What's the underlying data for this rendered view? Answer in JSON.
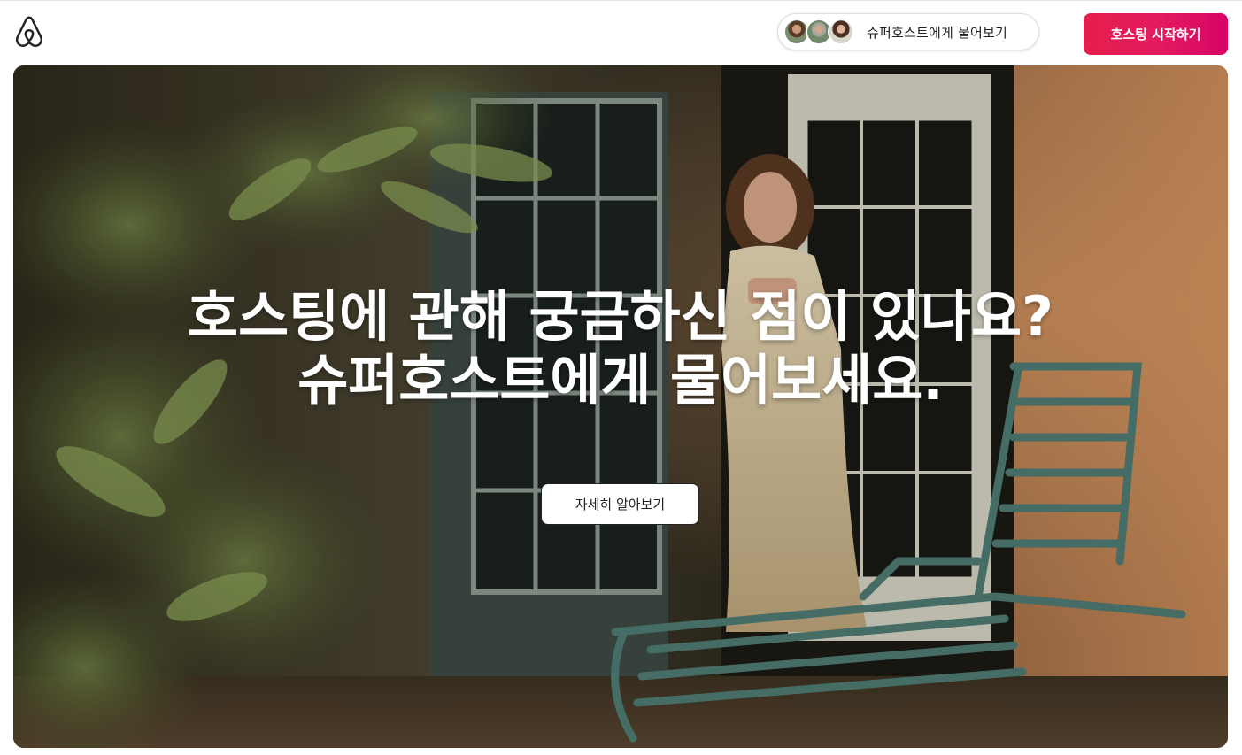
{
  "header": {
    "logo_icon": "airbnb-logo-icon",
    "ask_superhost_label": "슈퍼호스트에게 물어보기",
    "start_hosting_label": "호스팅 시작하기",
    "accent_color": "#E31C5F"
  },
  "hero": {
    "headline_line1": "호스팅에 관해 궁금하신 점이 있나요?",
    "headline_line2": "슈퍼호스트에게 물어보세요.",
    "learn_more_label": "자세히 알아보기"
  }
}
